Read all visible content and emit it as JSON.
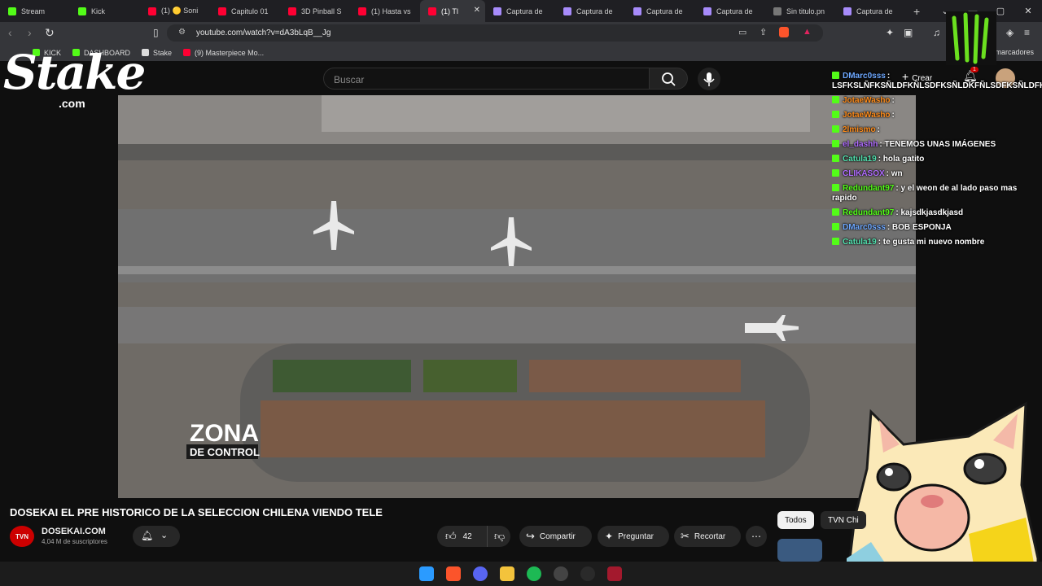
{
  "browser": {
    "tabs": [
      {
        "label": "Stream",
        "color": "#53fc18"
      },
      {
        "label": "Kick",
        "color": "#53fc18"
      },
      {
        "label": "(1) 🟡 Soni",
        "color": "#ff0033"
      },
      {
        "label": "Capitulo 01",
        "color": "#ff0033"
      },
      {
        "label": "3D Pinball S",
        "color": "#ff0033"
      },
      {
        "label": "(1) Hasta vs",
        "color": "#ff0033"
      },
      {
        "label": "(1) Tl",
        "color": "#ff0033"
      },
      {
        "label": "Captura de",
        "color": "#a78bfa"
      },
      {
        "label": "Captura de",
        "color": "#a78bfa"
      },
      {
        "label": "Captura de",
        "color": "#a78bfa"
      },
      {
        "label": "Captura de",
        "color": "#a78bfa"
      },
      {
        "label": "Sin titulo.pn",
        "color": "#777777"
      },
      {
        "label": "Captura de",
        "color": "#a78bfa"
      }
    ],
    "url": "youtube.com/watch?v=dA3bLqB__Jg",
    "bookmarks": [
      {
        "label": "KICK",
        "color": "#53fc18"
      },
      {
        "label": "DASHBOARD",
        "color": "#53fc18"
      },
      {
        "label": "Stake",
        "color": "#dddddd"
      },
      {
        "label": "(9) Masterpiece Mo...",
        "color": "#ff0033"
      }
    ],
    "all_bookmarks": "Todos los marcadores"
  },
  "youtube": {
    "search_placeholder": "Buscar",
    "create_label": "Crear",
    "notif_count": "1",
    "video_overlay_line1": "ZONA",
    "video_overlay_line2": "DE CONTROL",
    "video_title": "DOSEKAI EL PRE HISTORICO DE LA SELECCION CHILENA VIENDO TELE",
    "channel_avatar": "TVN",
    "channel_name": "DOSEKAI.COM",
    "subscribers": "4,04 M de suscriptores",
    "likes": "42",
    "share": "Compartir",
    "ask": "Preguntar",
    "clip": "Recortar",
    "filters": [
      "Todos",
      "TVN Chi"
    ]
  },
  "overlay": {
    "stake_logo": "Stake",
    "stake_com": ".com"
  },
  "chat": [
    {
      "user": "DMarc0sss",
      "user_color": "#6ea8ff",
      "text": "LSFKSLÑFKSÑLDFKÑLSDFKSÑLDKFÑLSDFKSÑLDFKSDLÑFSD"
    },
    {
      "user": "JotaeWasho",
      "user_color": "#ff8c1a",
      "text": ""
    },
    {
      "user": "JotaeWasho",
      "user_color": "#ff8c1a",
      "text": ""
    },
    {
      "user": "2lmismo",
      "user_color": "#ff8c1a",
      "text": ""
    },
    {
      "user": "el_dashh",
      "user_color": "#b06cff",
      "text": "TENEMOS UNAS IMÁGENES"
    },
    {
      "user": "Catula19",
      "user_color": "#53e2b0",
      "text": "hola gatito"
    },
    {
      "user": "CLIKASOX",
      "user_color": "#b06cff",
      "text": "wn"
    },
    {
      "user": "Redundant97",
      "user_color": "#53fc18",
      "text": "y el weon de al lado paso mas rapido"
    },
    {
      "user": "Redundant97",
      "user_color": "#53fc18",
      "text": "kajsdkjasdkjasd"
    },
    {
      "user": "DMarc0sss",
      "user_color": "#6ea8ff",
      "text": "BOB ESPONJA"
    },
    {
      "user": "Catula19",
      "user_color": "#53e2b0",
      "text": "te gusta mi nuevo nombre"
    }
  ]
}
